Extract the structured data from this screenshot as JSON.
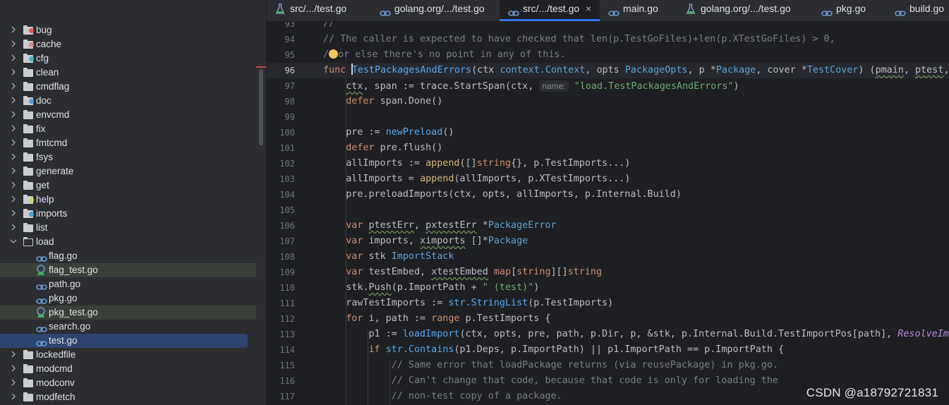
{
  "sidebar": {
    "items": [
      {
        "label": "bug",
        "kind": "folder",
        "badge": "#e55555"
      },
      {
        "label": "cache",
        "kind": "folder",
        "badge": "#d2877a"
      },
      {
        "label": "cfg",
        "kind": "folder",
        "badge": "#37b5c9"
      },
      {
        "label": "clean",
        "kind": "folder"
      },
      {
        "label": "cmdflag",
        "kind": "folder"
      },
      {
        "label": "doc",
        "kind": "folder",
        "badge": "#4e9bde"
      },
      {
        "label": "envcmd",
        "kind": "folder"
      },
      {
        "label": "fix",
        "kind": "folder"
      },
      {
        "label": "fmtcmd",
        "kind": "folder"
      },
      {
        "label": "fsys",
        "kind": "folder"
      },
      {
        "label": "generate",
        "kind": "folder"
      },
      {
        "label": "get",
        "kind": "folder"
      },
      {
        "label": "help",
        "kind": "folder",
        "badge": "#c8d94a"
      },
      {
        "label": "imports",
        "kind": "folder",
        "badge": "#3fa1e6"
      },
      {
        "label": "list",
        "kind": "folder"
      },
      {
        "label": "load",
        "kind": "folder-open"
      },
      {
        "label": "flag.go",
        "kind": "gofile"
      },
      {
        "label": "flag_test.go",
        "kind": "testfile",
        "highlight": true
      },
      {
        "label": "path.go",
        "kind": "gofile"
      },
      {
        "label": "pkg.go",
        "kind": "gofile"
      },
      {
        "label": "pkg_test.go",
        "kind": "testfile",
        "highlight": true
      },
      {
        "label": "search.go",
        "kind": "gofile"
      },
      {
        "label": "test.go",
        "kind": "gofile",
        "selected": true
      },
      {
        "label": "lockedfile",
        "kind": "folder"
      },
      {
        "label": "modcmd",
        "kind": "folder"
      },
      {
        "label": "modconv",
        "kind": "folder"
      },
      {
        "label": "modfetch",
        "kind": "folder"
      }
    ]
  },
  "tabs": [
    {
      "label": "src/.../test.go",
      "icon": "flask-icon"
    },
    {
      "label": "golang.org/.../test.go",
      "icon": "gopher-icon"
    },
    {
      "label": "src/.../test.go",
      "icon": "gopher-icon",
      "active": true,
      "close": "×"
    },
    {
      "label": "main.go",
      "icon": "gopher-icon"
    },
    {
      "label": "golang.org/.../test.go",
      "icon": "flask-icon"
    },
    {
      "label": "pkg.go",
      "icon": "gopher-icon"
    },
    {
      "label": "build.go",
      "icon": "gopher-icon"
    }
  ],
  "editor": {
    "current_line": "96",
    "lines": [
      {
        "n": "93",
        "html": "<span class=\"c\">//</span>"
      },
      {
        "n": "94",
        "html": "<span class=\"c\">// The caller is expected to have checked that len(p.TestGoFiles)+len(p.XTestGoFiles) &gt; 0,</span>"
      },
      {
        "n": "95",
        "html": "<span class=\"c\">/</span><span class=\"bulb\"></span><span class=\"c\">or else there's no point in any of this.</span>"
      },
      {
        "n": "96",
        "html": "<span class=\"k\">func </span><span class=\"caret\"></span><span class=\"fn\">TestPackagesAndErrors</span>(ctx <span class=\"ty\">context.Context</span>, opts <span class=\"ty\">PackageOpts</span>, p *<span class=\"ty\">Package</span>, cover *<span class=\"ty\">TestCover</span>) (<span class=\"wavy\">pmain</span>, <span class=\"wavy\">ptest</span>, <span class=\"wavy\">pxt</span>"
      },
      {
        "n": "97",
        "html": "    <span class=\"wavy\">ctx</span>, span := trace.StartSpan(ctx, <span class=\"hint\">name:</span> <span class=\"s\">\"load.TestPackagesAndErrors\"</span>)"
      },
      {
        "n": "98",
        "html": "    <span class=\"k\">defer </span>span.Done()"
      },
      {
        "n": "99",
        "html": ""
      },
      {
        "n": "100",
        "html": "    pre := <span class=\"f\">newPreload</span>()"
      },
      {
        "n": "101",
        "html": "    <span class=\"k\">defer </span>pre.flush()"
      },
      {
        "n": "102",
        "html": "    allImports := <span class=\"b\">append</span>([]<span class=\"k\">string</span>{}, p.TestImports...)"
      },
      {
        "n": "103",
        "html": "    allImports = <span class=\"b\">append</span>(allImports, p.XTestImports...)"
      },
      {
        "n": "104",
        "html": "    pre.preloadImports(ctx, opts, allImports, p.Internal.Build)"
      },
      {
        "n": "105",
        "html": ""
      },
      {
        "n": "106",
        "html": "    <span class=\"k\">var </span><span class=\"wavy\">ptestErr</span>, <span class=\"wavy\">pxtestErr</span> *<span class=\"ty\">PackageError</span>"
      },
      {
        "n": "107",
        "html": "    <span class=\"k\">var </span>imports, <span class=\"wavy\">ximports</span> []*<span class=\"ty\">Package</span>"
      },
      {
        "n": "108",
        "html": "    <span class=\"k\">var </span>stk <span class=\"ty\">ImportStack</span>"
      },
      {
        "n": "109",
        "html": "    <span class=\"k\">var </span>testEmbed, <span class=\"wavy\">xtestEmbed</span> <span class=\"k\">map</span>[<span class=\"k\">string</span>][]<span class=\"k\">string</span>"
      },
      {
        "n": "110",
        "html": "    stk.<span class=\"wavy\">Push</span>(p.ImportPath + <span class=\"s\">\" (test)\"</span>)"
      },
      {
        "n": "111",
        "html": "    rawTestImports := <span class=\"f\">str.StringList</span>(p.TestImports)"
      },
      {
        "n": "112",
        "html": "    <span class=\"k\">for </span>i, path := <span class=\"k\">range </span>p.TestImports {"
      },
      {
        "n": "113",
        "html": "        p1 := <span class=\"f\">loadImport</span>(ctx, opts, pre, path, p.Dir, p, &amp;stk, p.Internal.Build.TestImportPos[path], <span class=\"p\">ResolveImport</span>"
      },
      {
        "n": "114",
        "html": "        <span class=\"k\">if </span><span class=\"f\">str.Contains</span>(p1.Deps, p.ImportPath) || p1.ImportPath == p.ImportPath {"
      },
      {
        "n": "115",
        "html": "            <span class=\"c\">// Same error that loadPackage returns (via reusePackage) in pkg.go.</span>"
      },
      {
        "n": "116",
        "html": "            <span class=\"c\">// Can't change that code, because that code is only for loading the</span>"
      },
      {
        "n": "117",
        "html": "            <span class=\"c\">// non-test copy of a package.</span>"
      }
    ]
  },
  "watermark": "CSDN @a18792721831"
}
